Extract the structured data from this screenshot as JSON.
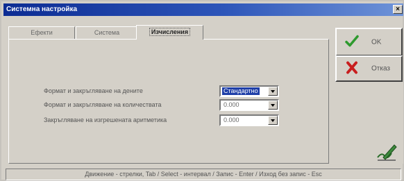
{
  "window": {
    "title": "Системна настройка"
  },
  "tabs": [
    {
      "label": "Ефекти",
      "active": false
    },
    {
      "label": "Система",
      "active": false
    },
    {
      "label": "Изчисления",
      "active": true
    }
  ],
  "fields": [
    {
      "label": "Формат и закръгляване на дените",
      "value": "Стандартно",
      "selected": true
    },
    {
      "label": "Формат и закръгляване на количествата",
      "value": "0.000",
      "selected": false
    },
    {
      "label": "Закръгляване на изгрешената аритметика",
      "value": "0.000",
      "selected": false
    }
  ],
  "buttons": {
    "ok_label": "OK",
    "cancel_label": "Отказ"
  },
  "status_bar": {
    "text": "Движение - стрелки, Tab / Select - интервал / Запис - Enter / Изход без запис - Esc"
  },
  "icons": {
    "ok": "green-check-icon",
    "cancel": "red-cross-icon",
    "close": "close-icon",
    "sign": "pen-sign-icon"
  },
  "colors": {
    "title_bar": "#0c2c93",
    "selection": "#1f3fa8",
    "face": "#d4d0c8"
  }
}
